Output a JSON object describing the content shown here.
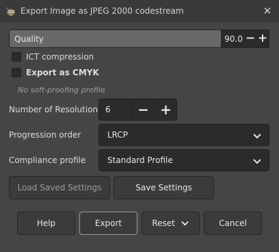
{
  "window": {
    "title": "Export Image as JPEG 2000 codestream",
    "app_icon": "gimp-icon",
    "close_icon": "✕"
  },
  "quality": {
    "label": "Quality",
    "value": "90.0",
    "fraction": 0.9,
    "minus": "−",
    "plus": "+"
  },
  "options": {
    "ict_compression": {
      "label": "ICT compression",
      "checked": false
    },
    "export_cmyk": {
      "label": "Export as CMYK",
      "checked": false
    },
    "softproof_note": "No soft-proofing profile"
  },
  "resolutions": {
    "label": "Number of Resolutions",
    "value": "6",
    "minus": "−",
    "plus": "+"
  },
  "progression": {
    "label": "Progression order",
    "value": "LRCP"
  },
  "compliance": {
    "label": "Compliance profile",
    "value": "Standard Profile"
  },
  "settings": {
    "load": "Load Saved Settings",
    "save": "Save Settings"
  },
  "footer": {
    "help": "Help",
    "export": "Export",
    "reset": "Reset",
    "cancel": "Cancel"
  },
  "colors": {
    "background": "#454545",
    "field": "#2b2b2b",
    "slider_fill": "#686868"
  }
}
